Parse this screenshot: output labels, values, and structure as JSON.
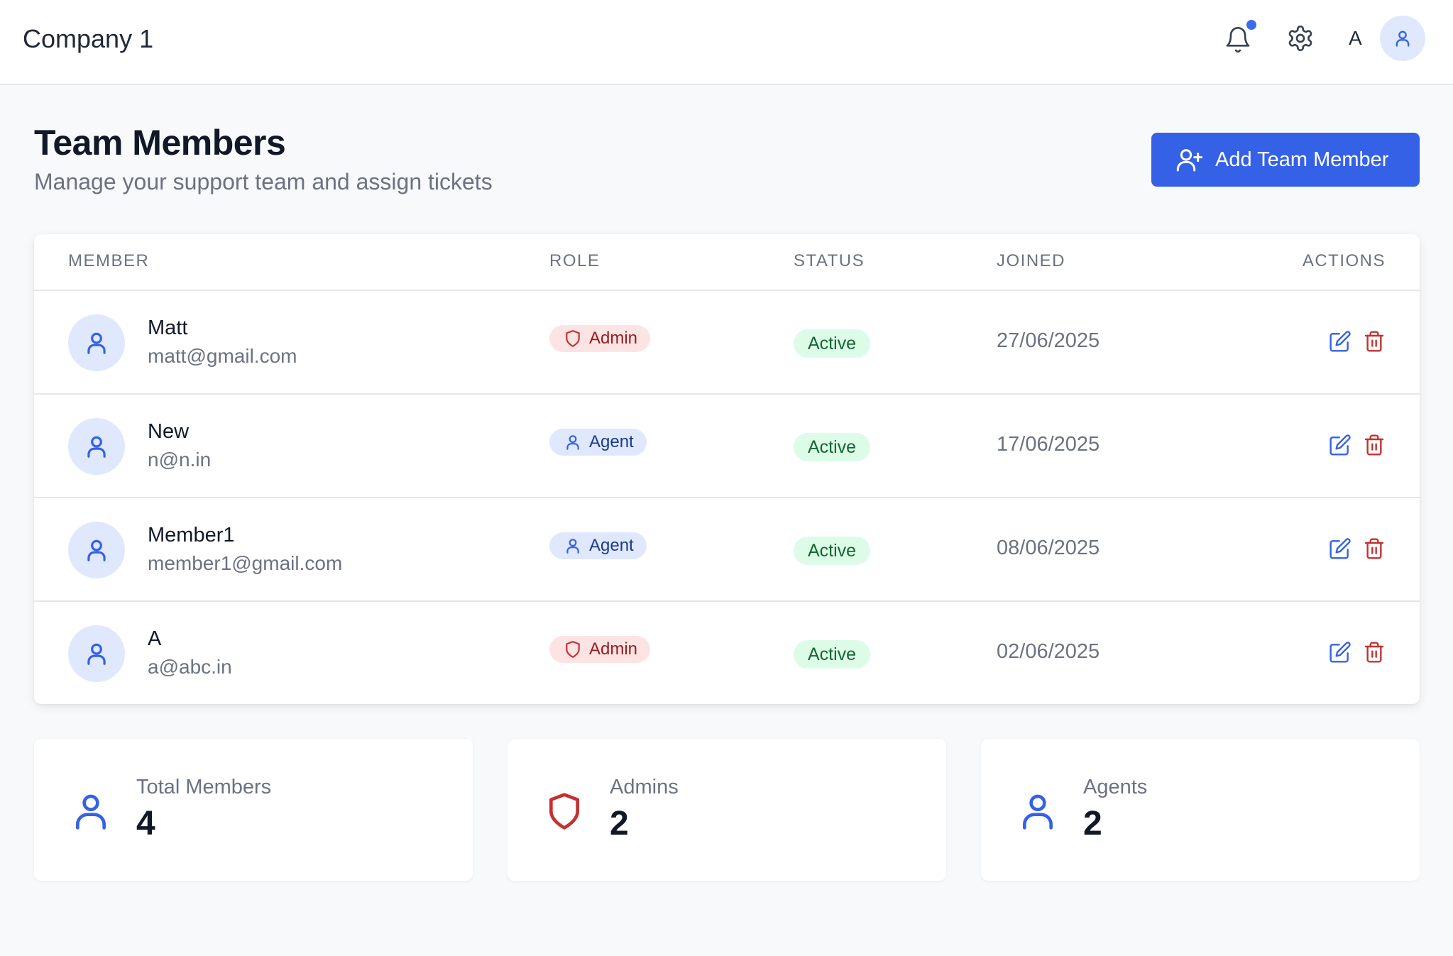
{
  "header": {
    "company": "Company 1",
    "user_initial": "A",
    "notification_dot_color": "#3b6cf0"
  },
  "page": {
    "title": "Team Members",
    "subtitle": "Manage your support team and assign tickets",
    "add_button_label": "Add Team Member"
  },
  "table": {
    "columns": [
      "MEMBER",
      "ROLE",
      "STATUS",
      "JOINED",
      "ACTIONS"
    ],
    "rows": [
      {
        "name": "Matt",
        "email": "matt@gmail.com",
        "role": "Admin",
        "status": "Active",
        "joined": "27/06/2025"
      },
      {
        "name": "New",
        "email": "n@n.in",
        "role": "Agent",
        "status": "Active",
        "joined": "17/06/2025"
      },
      {
        "name": "Member1",
        "email": "member1@gmail.com",
        "role": "Agent",
        "status": "Active",
        "joined": "08/06/2025"
      },
      {
        "name": "A",
        "email": "a@abc.in",
        "role": "Admin",
        "status": "Active",
        "joined": "02/06/2025"
      }
    ]
  },
  "stats": [
    {
      "label": "Total Members",
      "value": "4",
      "icon": "user-icon"
    },
    {
      "label": "Admins",
      "value": "2",
      "icon": "shield-icon"
    },
    {
      "label": "Agents",
      "value": "2",
      "icon": "user-icon"
    }
  ],
  "colors": {
    "primary": "#3461e6",
    "admin": "#c53030",
    "agent": "#3461e6",
    "active": "#166534"
  }
}
